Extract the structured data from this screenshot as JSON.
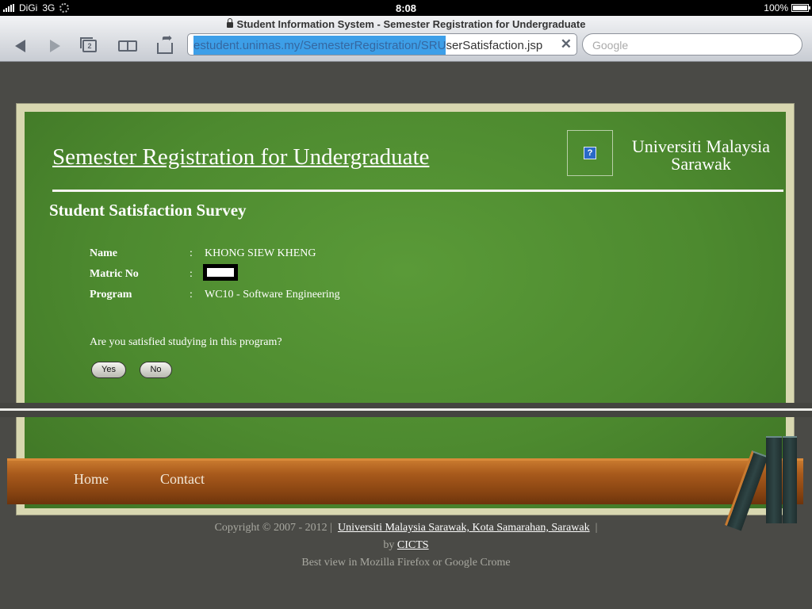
{
  "status_bar": {
    "carrier": "DiGi",
    "network": "3G",
    "time": "8:08",
    "battery": "100%"
  },
  "browser": {
    "page_title": "Student Information System - Semester Registration for Undergraduate",
    "url_selected": "estudent.unimas.my/SemesterRegistration/SRU",
    "url_rest": "serSatisfaction.jsp",
    "search_placeholder": "Google",
    "tab_count": "2"
  },
  "header": {
    "title": "Semester Registration for Undergraduate",
    "logo_icon": "?",
    "university_line1": "Universiti Malaysia",
    "university_line2": "Sarawak"
  },
  "survey": {
    "heading": "Student Satisfaction Survey",
    "fields": [
      {
        "label": "Name",
        "colon": ":",
        "value": "KHONG SIEW KHENG"
      },
      {
        "label": "Matric No",
        "colon": ":",
        "value": ""
      },
      {
        "label": "Program",
        "colon": ":",
        "value": "WC10 - Software Engineering"
      }
    ],
    "question": "Are you satisfied studying in this program?",
    "yes_label": "Yes",
    "no_label": "No"
  },
  "nav": {
    "home": "Home",
    "contact": "Contact"
  },
  "footer": {
    "copyright": "Copyright © 2007 - 2012 |",
    "university_link": "Universiti Malaysia Sarawak, Kota Samarahan, Sarawak",
    "separator": "|",
    "by": "by",
    "cicts_link": "CICTS",
    "best_view": "Best view in Mozilla Firefox or Google Crome"
  },
  "colors": {
    "board_green": "#4d8a2f",
    "shelf_wood": "#a85a1c",
    "url_selection": "#3d9fe8"
  }
}
